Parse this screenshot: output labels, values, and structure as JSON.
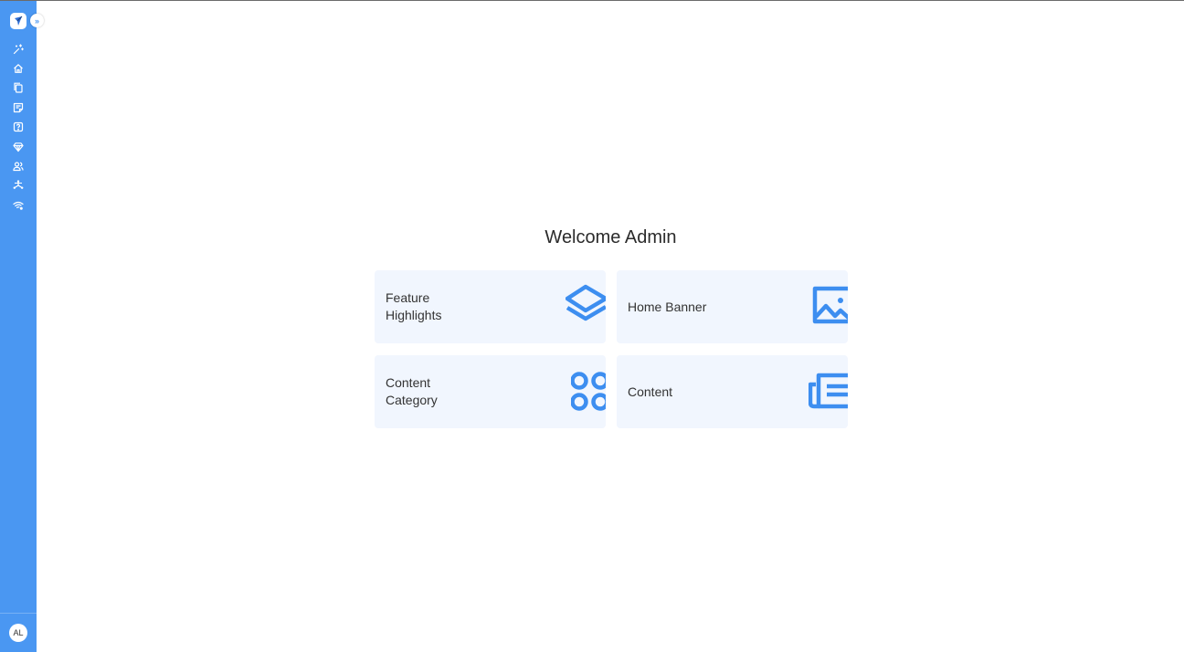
{
  "sidebar": {
    "logo_icon": "app-logo-icon",
    "expand_glyph": "»",
    "items": [
      {
        "name": "sidebar-item-ai",
        "icon": "sparkle-wand-icon"
      },
      {
        "name": "sidebar-item-home",
        "icon": "home-icon"
      },
      {
        "name": "sidebar-item-pages",
        "icon": "copy-pages-icon"
      },
      {
        "name": "sidebar-item-notes",
        "icon": "note-icon"
      },
      {
        "name": "sidebar-item-help",
        "icon": "help-square-icon"
      },
      {
        "name": "sidebar-item-premium",
        "icon": "diamond-icon"
      },
      {
        "name": "sidebar-item-users",
        "icon": "users-icon"
      },
      {
        "name": "sidebar-item-integrations",
        "icon": "asterisk-nodes-icon"
      },
      {
        "name": "sidebar-item-network",
        "icon": "wifi-settings-icon"
      }
    ],
    "avatar_initials": "AL"
  },
  "main": {
    "welcome": "Welcome Admin",
    "cards": [
      {
        "name": "card-feature-highlights",
        "label_line1": "Feature",
        "label_line2": "Highlights",
        "icon": "layers-icon"
      },
      {
        "name": "card-home-banner",
        "label": "Home Banner",
        "icon": "image-icon"
      },
      {
        "name": "card-content-category",
        "label_line1": "Content",
        "label_line2": "Category",
        "icon": "category-circles-icon"
      },
      {
        "name": "card-content",
        "label": "Content",
        "icon": "newspaper-icon"
      }
    ]
  },
  "colors": {
    "sidebar": "#4a97f2",
    "accent": "#3d8ef0",
    "card_bg": "#f1f6fe",
    "text": "#333333"
  }
}
